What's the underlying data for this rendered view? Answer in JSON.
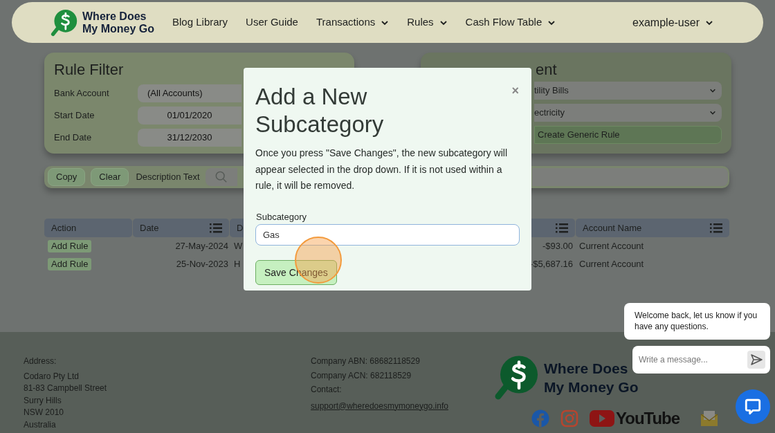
{
  "nav": {
    "brand": [
      "Where Does",
      "My Money Go"
    ],
    "items": [
      {
        "label": "Blog Library",
        "dropdown": false
      },
      {
        "label": "User Guide",
        "dropdown": false
      },
      {
        "label": "Transactions",
        "dropdown": true
      },
      {
        "label": "Rules",
        "dropdown": true
      },
      {
        "label": "Cash Flow Table",
        "dropdown": true
      }
    ],
    "user": {
      "label": "example-user",
      "dropdown": true
    }
  },
  "rule_filter": {
    "title": "Rule Filter",
    "fields": [
      {
        "label": "Bank Account",
        "value": "(All Accounts)"
      },
      {
        "label": "Start Date",
        "value": "01/01/2020"
      },
      {
        "label": "End Date",
        "value": "31/12/2030"
      }
    ]
  },
  "rule_assignment": {
    "title": "ent",
    "selects": [
      "tility Bills",
      "ectricity"
    ],
    "button": "Create Generic Rule"
  },
  "toolbar": {
    "buttons": [
      "Copy",
      "Clear"
    ],
    "label": "Description Text"
  },
  "table": {
    "columns": [
      {
        "label": "Action",
        "menu": false
      },
      {
        "label": "Date",
        "menu": true
      },
      {
        "label": "D",
        "menu": false
      },
      {
        "menu": true
      },
      {
        "label": "Account Name",
        "menu": true
      }
    ],
    "rows": [
      {
        "action": "Add Rule",
        "date": "27-May-2024",
        "column_3": "W",
        "amount": "-$93.00",
        "account": "Current Account"
      },
      {
        "action": "Add Rule",
        "date": "25-Nov-2023",
        "column_3": "H",
        "amount": "-$5,687.16",
        "account": "Current Account"
      }
    ]
  },
  "modal": {
    "title": "Add a New Subcategory",
    "close": "×",
    "text": "Once you press \"Save Changes\", the new subcategory will appear selected in the drop down. If it is not used within a rule, it will be removed.",
    "field_label": "Subcategory",
    "value": "Gas",
    "button": "Save Changes"
  },
  "footer": {
    "address_label": "Address:",
    "address_lines": [
      "Codaro Pty Ltd",
      "81-83 Campbell Street",
      "Surry Hills",
      "NSW 2010",
      "Australia"
    ],
    "company_lines": [
      "Company ABN: 68682118529",
      "Company ACN: 682118529",
      "Contact:"
    ],
    "email": "support@wheredoesmymoneygo.info",
    "brand": [
      "Where Does",
      "My Money Go"
    ],
    "youtube_label": "YouTube"
  },
  "chat": {
    "message": "Welcome back, let us know if you have any questions.",
    "placeholder": "Write a message..."
  }
}
